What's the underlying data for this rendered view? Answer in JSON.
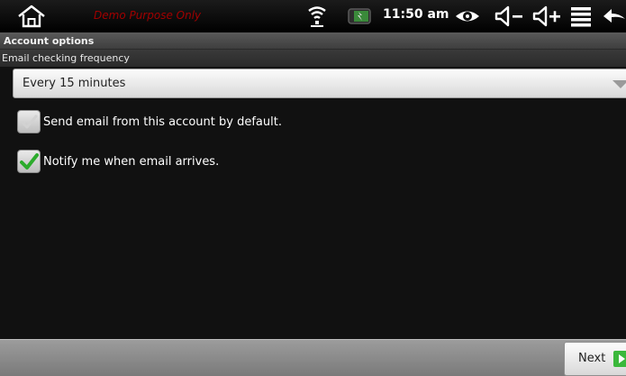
{
  "status_bar": {
    "watermark": "Demo Purpose Only",
    "time": "11:50 am",
    "icons": [
      "home-icon",
      "wifi-icon",
      "battery-icon",
      "eye-icon",
      "volume-down-icon",
      "volume-up-icon",
      "menu-icon",
      "back-icon"
    ]
  },
  "screen": {
    "section_title": "Account options",
    "frequency_label": "Email checking frequency",
    "frequency_value": "Every 15 minutes"
  },
  "options": [
    {
      "label": "Send email from this account by default.",
      "checked": false
    },
    {
      "label": "Notify me when email arrives.",
      "checked": true
    }
  ],
  "footer": {
    "next_label": "Next"
  },
  "colors": {
    "check_green": "#2cab2c",
    "watermark_red": "#a00000",
    "next_arrow_green": "#3bb83b"
  }
}
